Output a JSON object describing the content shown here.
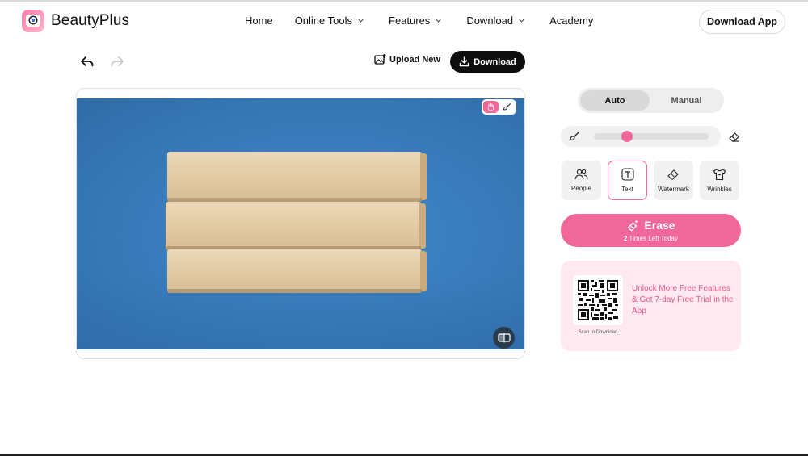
{
  "header": {
    "brand": "BeautyPlus",
    "nav": [
      {
        "label": "Home",
        "has_dropdown": false
      },
      {
        "label": "Online Tools",
        "has_dropdown": true
      },
      {
        "label": "Features",
        "has_dropdown": true
      },
      {
        "label": "Download",
        "has_dropdown": true
      },
      {
        "label": "Academy",
        "has_dropdown": false
      }
    ],
    "download_app_label": "Download App"
  },
  "toolbar": {
    "undo_icon": "undo-icon",
    "redo_icon": "redo-icon",
    "upload_new_label": "Upload New",
    "download_label": "Download"
  },
  "canvas": {
    "image_description_icon": "photo",
    "tools": [
      {
        "name": "hand-icon",
        "active": true
      },
      {
        "name": "brush-icon",
        "active": false
      }
    ],
    "compare_icon": "compare-icon"
  },
  "panel": {
    "modes": [
      {
        "label": "Auto",
        "active": true
      },
      {
        "label": "Manual",
        "active": false
      }
    ],
    "brush_size": 0.29,
    "categories": [
      {
        "label": "People",
        "icon": "people-icon",
        "selected": false
      },
      {
        "label": "Text",
        "icon": "text-icon",
        "selected": true
      },
      {
        "label": "Watermark",
        "icon": "eraser-icon",
        "selected": false
      },
      {
        "label": "Wrinkles",
        "icon": "shirt-icon",
        "selected": false
      }
    ],
    "erase": {
      "label": "Erase",
      "count": "2",
      "sub_label": "Times Left Today"
    },
    "promo": {
      "qr_caption": "Scan to Download",
      "line1": "Unlock More Free Features",
      "line2": "& Get 7-day Free Trial in the App"
    }
  },
  "colors": {
    "accent": "#f0679a",
    "dark_button": "#0d0d0d",
    "promo_bg": "#fde9ef"
  }
}
